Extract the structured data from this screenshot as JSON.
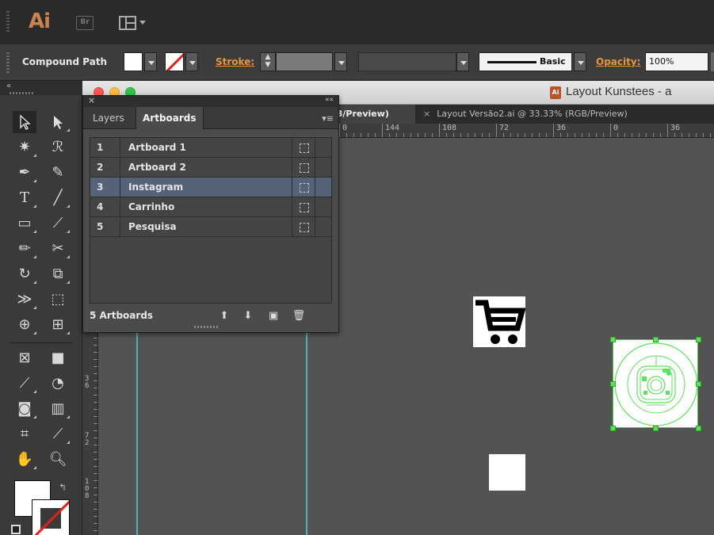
{
  "app": {
    "logo": "Ai",
    "bridge_label": "Br",
    "title": "Layout Kunstees - a"
  },
  "control_bar": {
    "selection_type": "Compound Path",
    "stroke_label": "Stroke:",
    "brush_name": "Basic",
    "opacity_label": "Opacity:",
    "opacity_value": "100%"
  },
  "tabs": [
    {
      "label": "B/Preview)"
    },
    {
      "label": "Layout Versão2.ai @ 33.33% (RGB/Preview)"
    }
  ],
  "ruler": {
    "h_ticks": [
      "0",
      "144",
      "108",
      "72",
      "36",
      "0",
      "36"
    ],
    "v_labels": [
      "3\n6",
      "7\n2",
      "1\n0\n8"
    ]
  },
  "artboards_panel": {
    "tab_layers": "Layers",
    "tab_artboards": "Artboards",
    "rows": [
      {
        "num": "1",
        "name": "Artboard 1",
        "selected": false
      },
      {
        "num": "2",
        "name": "Artboard 2",
        "selected": false
      },
      {
        "num": "3",
        "name": "Instagram",
        "selected": true
      },
      {
        "num": "4",
        "name": "Carrinho",
        "selected": false
      },
      {
        "num": "5",
        "name": "Pesquisa",
        "selected": false
      }
    ],
    "count_label": "5 Artboards"
  },
  "colors": {
    "accent_orange": "#e8943a",
    "selection_green": "#3fd23f",
    "guide_cyan": "#4fb3b0",
    "row_selected": "#556378"
  },
  "icons": [
    "selection-icon",
    "direct-selection-icon",
    "magic-wand-icon",
    "lasso-icon",
    "pen-icon",
    "curvature-icon",
    "type-icon",
    "line-icon",
    "rectangle-icon",
    "paintbrush-icon",
    "pencil-icon",
    "scissors-icon",
    "rotate-icon",
    "scale-icon",
    "width-icon",
    "free-transform-icon",
    "shape-builder-icon",
    "perspective-grid-icon",
    "mesh-icon",
    "gradient-icon",
    "eyedropper-icon",
    "blend-icon",
    "symbol-sprayer-icon",
    "column-graph-icon",
    "artboard-icon",
    "slice-icon",
    "hand-icon",
    "zoom-icon"
  ]
}
